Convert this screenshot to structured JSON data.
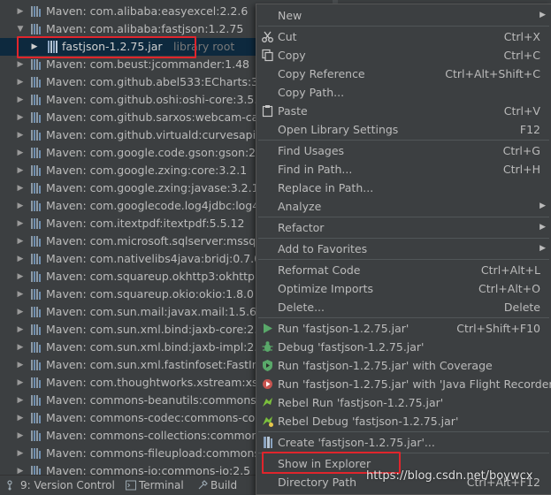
{
  "tree": {
    "items": [
      {
        "label": "Maven: com.alibaba:easyexcel:2.2.6",
        "expanded": false
      },
      {
        "label": "Maven: com.alibaba:fastjson:1.2.75",
        "expanded": true
      },
      {
        "label": "fastjson-1.2.75.jar",
        "hint": "library root",
        "child": true,
        "selected": true
      },
      {
        "label": "Maven: com.beust:jcommander:1.48",
        "expanded": false
      },
      {
        "label": "Maven: com.github.abel533:ECharts:3.0.0",
        "expanded": false
      },
      {
        "label": "Maven: com.github.oshi:oshi-core:3.5.0",
        "expanded": false
      },
      {
        "label": "Maven: com.github.sarxos:webcam-captu",
        "expanded": false
      },
      {
        "label": "Maven: com.github.virtuald:curvesapi:1.0",
        "expanded": false
      },
      {
        "label": "Maven: com.google.code.gson:gson:2.8.",
        "expanded": false
      },
      {
        "label": "Maven: com.google.zxing:core:3.2.1",
        "expanded": false
      },
      {
        "label": "Maven: com.google.zxing:javase:3.2.1",
        "expanded": false
      },
      {
        "label": "Maven: com.googlecode.log4jdbc:log4jd",
        "expanded": false
      },
      {
        "label": "Maven: com.itextpdf:itextpdf:5.5.12",
        "expanded": false
      },
      {
        "label": "Maven: com.microsoft.sqlserver:mssql-jd",
        "expanded": false
      },
      {
        "label": "Maven: com.nativelibs4java:bridj:0.7.0",
        "expanded": false
      },
      {
        "label": "Maven: com.squareup.okhttp3:okhttp:3.3",
        "expanded": false
      },
      {
        "label": "Maven: com.squareup.okio:okio:1.8.0",
        "expanded": false
      },
      {
        "label": "Maven: com.sun.mail:javax.mail:1.5.6",
        "expanded": false
      },
      {
        "label": "Maven: com.sun.xml.bind:jaxb-core:2.1.14",
        "expanded": false
      },
      {
        "label": "Maven: com.sun.xml.bind:jaxb-impl:2.1.14",
        "expanded": false
      },
      {
        "label": "Maven: com.sun.xml.fastinfoset:FastInfos",
        "expanded": false
      },
      {
        "label": "Maven: com.thoughtworks.xstream:xstrea",
        "expanded": false
      },
      {
        "label": "Maven: commons-beanutils:commons-be",
        "expanded": false
      },
      {
        "label": "Maven: commons-codec:commons-code",
        "expanded": false
      },
      {
        "label": "Maven: commons-collections:commons-c",
        "expanded": false
      },
      {
        "label": "Maven: commons-fileupload:commons-fil",
        "expanded": false
      },
      {
        "label": "Maven: commons-io:commons-io:2.5",
        "expanded": false
      }
    ]
  },
  "bottom_bar": {
    "tabs": [
      {
        "label": "9: Version Control",
        "icon": "version-control-icon"
      },
      {
        "label": "Terminal",
        "icon": "terminal-icon"
      },
      {
        "label": "Build",
        "icon": "build-icon"
      }
    ]
  },
  "context_menu": {
    "items": [
      {
        "label": "New",
        "submenu": true
      },
      {
        "separator": true
      },
      {
        "label": "Cut",
        "shortcut": "Ctrl+X",
        "icon": "cut-icon"
      },
      {
        "label": "Copy",
        "shortcut": "Ctrl+C",
        "icon": "copy-icon"
      },
      {
        "label": "Copy Reference",
        "shortcut": "Ctrl+Alt+Shift+C"
      },
      {
        "label": "Copy Path...",
        "shortcut": ""
      },
      {
        "label": "Paste",
        "shortcut": "Ctrl+V",
        "icon": "paste-icon"
      },
      {
        "label": "Open Library Settings",
        "shortcut": "F12"
      },
      {
        "separator": true
      },
      {
        "label": "Find Usages",
        "shortcut": "Ctrl+G"
      },
      {
        "label": "Find in Path...",
        "shortcut": "Ctrl+H"
      },
      {
        "label": "Replace in Path...",
        "shortcut": ""
      },
      {
        "label": "Analyze",
        "submenu": true
      },
      {
        "separator": true
      },
      {
        "label": "Refactor",
        "submenu": true
      },
      {
        "separator": true
      },
      {
        "label": "Add to Favorites",
        "submenu": true
      },
      {
        "separator": true
      },
      {
        "label": "Reformat Code",
        "shortcut": "Ctrl+Alt+L"
      },
      {
        "label": "Optimize Imports",
        "shortcut": "Ctrl+Alt+O"
      },
      {
        "label": "Delete...",
        "shortcut": "Delete"
      },
      {
        "separator": true
      },
      {
        "label": "Run 'fastjson-1.2.75.jar'",
        "shortcut": "Ctrl+Shift+F10",
        "icon": "run-icon"
      },
      {
        "label": "Debug 'fastjson-1.2.75.jar'",
        "shortcut": "",
        "icon": "debug-icon"
      },
      {
        "label": "Run 'fastjson-1.2.75.jar' with Coverage",
        "shortcut": "",
        "icon": "coverage-icon"
      },
      {
        "label": "Run 'fastjson-1.2.75.jar' with 'Java Flight Recorder'",
        "shortcut": "",
        "icon": "flight-recorder-icon"
      },
      {
        "label": "Rebel Run 'fastjson-1.2.75.jar'",
        "shortcut": "",
        "icon": "rebel-run-icon"
      },
      {
        "label": "Rebel Debug 'fastjson-1.2.75.jar'",
        "shortcut": "",
        "icon": "rebel-debug-icon"
      },
      {
        "separator": true
      },
      {
        "label": "Create 'fastjson-1.2.75.jar'...",
        "shortcut": "",
        "icon": "create-icon"
      },
      {
        "separator": true
      },
      {
        "label": "Show in Explorer",
        "shortcut": "",
        "highlighted_box": true
      },
      {
        "label": "Directory Path",
        "shortcut": "Ctrl+Alt+F12"
      }
    ]
  },
  "watermark": "https://blog.csdn.net/boywcx",
  "colors": {
    "background": "#3c3f41",
    "selection": "#0d293e",
    "text": "#bbbbbb",
    "hint": "#787878",
    "highlight_box": "#e0252c"
  }
}
